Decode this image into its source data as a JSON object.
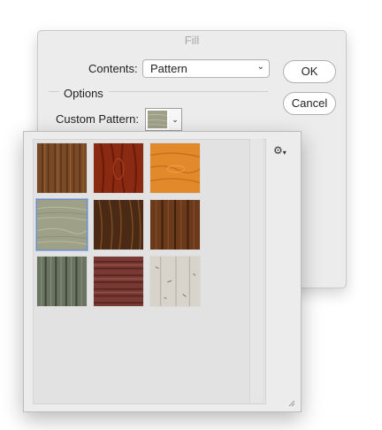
{
  "dialog": {
    "title": "Fill",
    "contents_label": "Contents:",
    "contents_value": "Pattern",
    "ok_label": "OK",
    "cancel_label": "Cancel",
    "options_label": "Options",
    "custom_pattern_label": "Custom Pattern:"
  },
  "picker": {
    "menu_icon": "gear-icon",
    "patterns": [
      {
        "name": "wood-brown-grain",
        "color": "#7a4a26"
      },
      {
        "name": "wood-red",
        "color": "#8a2a12"
      },
      {
        "name": "wood-orange",
        "color": "#e2892c"
      },
      {
        "name": "wood-grey-green",
        "color": "#9ea088",
        "selected": true
      },
      {
        "name": "wood-dark",
        "color": "#4a2a14"
      },
      {
        "name": "wood-brown-planks",
        "color": "#6a3a1a"
      },
      {
        "name": "wood-green-planks",
        "color": "#6a7460"
      },
      {
        "name": "wood-red-stripes",
        "color": "#7a3a34"
      },
      {
        "name": "wood-white-worn",
        "color": "#d8d4cc"
      }
    ]
  },
  "colors": {
    "dialog_bg": "#ececec",
    "selection": "#6a8ec8"
  }
}
